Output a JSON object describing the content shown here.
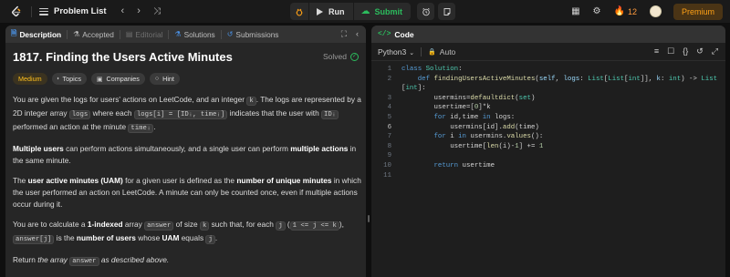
{
  "topbar": {
    "problem_list": "Problem List",
    "run_label": "Run",
    "submit_label": "Submit",
    "streak_count": "12",
    "premium_label": "Premium",
    "accent_color": "#ffa116",
    "submit_color": "#2cbb5d"
  },
  "left": {
    "tabs": [
      "Description",
      "Accepted",
      "Editorial",
      "Solutions",
      "Submissions"
    ],
    "title": "1817. Finding the Users Active Minutes",
    "status": "Solved",
    "chips": [
      "Medium",
      "Topics",
      "Companies",
      "Hint"
    ],
    "p1": {
      "t1": "You are given the logs for users' actions on LeetCode, and an integer ",
      "c1": "k",
      "t2": ". The logs are represented by a 2D integer array ",
      "c2": "logs",
      "t3": " where each ",
      "c3": "logs[i] = [IDᵢ, timeᵢ]",
      "t4": " indicates that the user with ",
      "c4": "IDᵢ",
      "t5": " performed an action at the minute ",
      "c5": "timeᵢ",
      "t6": "."
    },
    "p2": {
      "b1": "Multiple users",
      "t1": " can perform actions simultaneously, and a single user can perform ",
      "b2": "multiple actions",
      "t2": " in the same minute."
    },
    "p3": {
      "t1": "The ",
      "b1": "user active minutes (UAM)",
      "t2": " for a given user is defined as the ",
      "b2": "number of unique minutes",
      "t3": " in which the user performed an action on LeetCode. A minute can only be counted once, even if multiple actions occur during it."
    },
    "p4": {
      "t1": "You are to calculate a ",
      "b1": "1-indexed",
      "t2": " array ",
      "c1": "answer",
      "t3": " of size ",
      "c2": "k",
      "t4": " such that, for each ",
      "c3": "j",
      "t5": " (",
      "c4": "1 <= j <= k",
      "t6": "), ",
      "c5": "answer[j]",
      "t7": " is the ",
      "b2": "number of users",
      "t8": " whose ",
      "b3": "UAM",
      "t9": " equals ",
      "c6": "j",
      "t10": "."
    },
    "p5": {
      "t1": "Return ",
      "e1": "the array ",
      "c1": "answer",
      "e2": " as described above."
    }
  },
  "right": {
    "code_tab": "Code",
    "language": "Python3",
    "auto_label": "Auto",
    "line_numbers": [
      "1",
      "",
      "2",
      "3",
      "4",
      "5",
      "6",
      "7",
      "8",
      "9",
      "10",
      "11"
    ]
  }
}
